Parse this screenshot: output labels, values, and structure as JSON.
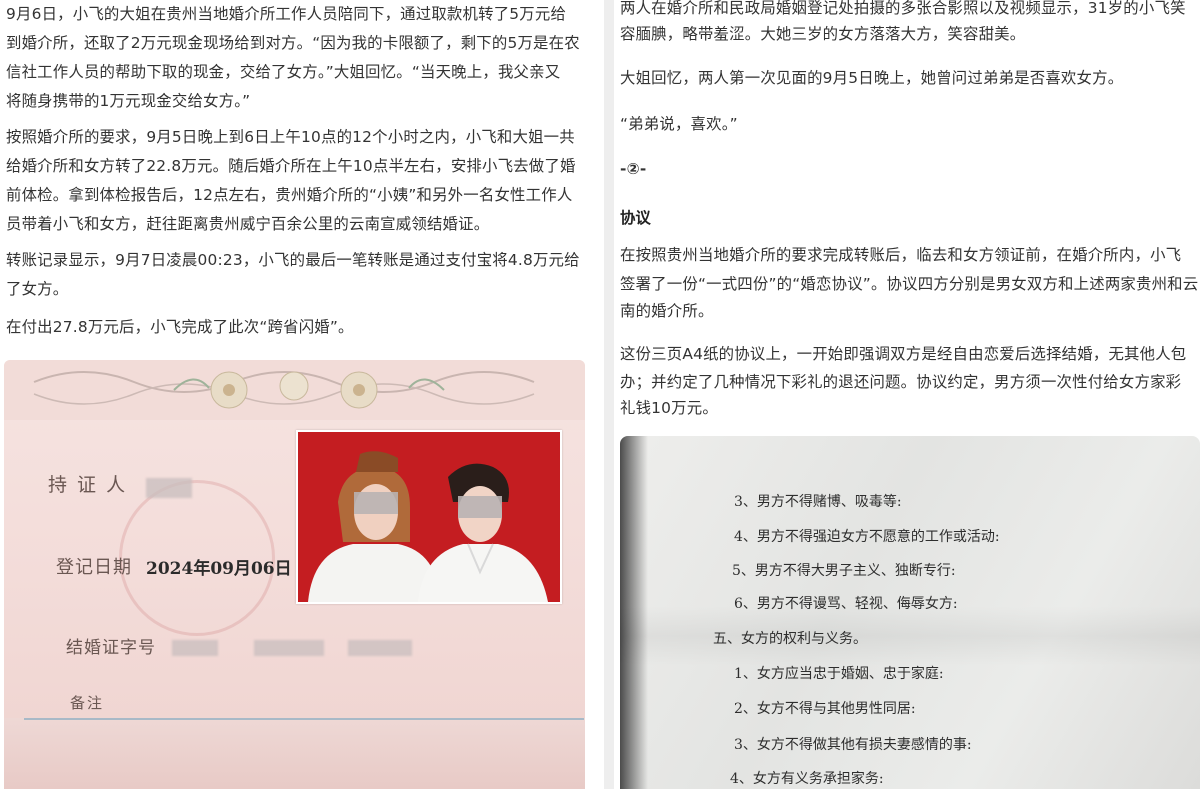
{
  "left": {
    "paragraphs": [
      "9月6日，小飞的大姐在贵州当地婚介所工作人员陪同下，通过取款机转了5万元给",
      "到婚介所，还取了2万元现金现场给到对方。“因为我的卡限额了，剩下的5万是在农",
      "信社工作人员的帮助下取的现金，交给了女方。”大姐回忆。“当天晚上，我父亲又",
      "将随身携带的1万元现金交给女方。”",
      "按照婚介所的要求，9月5日晚上到6日上午10点的12个小时之内，小飞和大姐一共",
      "给婚介所和女方转了22.8万元。随后婚介所在上午10点半左右，安排小飞去做了婚",
      "前体检。拿到体检报告后，12点左右，贵州婚介所的“小姨”和另外一名女性工作人",
      "员带着小飞和女方，赶往距离贵州威宁百余公里的云南宣威领结婚证。",
      "转账记录显示，9月7日凌晨00:23，小飞的最后一笔转账是通过支付宝将4.8万元给",
      "了女方。",
      "在付出27.8万元后，小飞完成了此次“跨省闪婚”。"
    ],
    "certificate": {
      "holder_label": "持 证 人",
      "date_label": "登记日期",
      "date_value": "2024年09月06日",
      "cert_no_label": "结婚证字号",
      "remark_label": "备注"
    }
  },
  "right": {
    "paragraphs": [
      "两人在婚介所和民政局婚姻登记处拍摄的多张合影照以及视频显示，31岁的小飞笑",
      "容腼腆，略带羞涩。大她三岁的女方落落大方，笑容甜美。",
      "大姐回忆，两人第一次见面的9月5日晚上，她曾问过弟弟是否喜欢女方。",
      "“弟弟说，喜欢。”",
      "-②-",
      "协议",
      "在按照贵州当地婚介所的要求完成转账后，临去和女方领证前，在婚介所内，小飞",
      "签署了一份“一式四份”的“婚恋协议”。协议四方分别是男女双方和上述两家贵州和云",
      "南的婚介所。",
      "这份三页A4纸的协议上，一开始即强调双方是经自由恋爱后选择结婚，无其他人包",
      "办；并约定了几种情况下彩礼的退还问题。协议约定，男方须一次性付给女方家彩",
      "礼钱10万元。"
    ],
    "agreement_lines": [
      "3、男方不得赌博、吸毒等:",
      "4、男方不得强迫女方不愿意的工作或活动:",
      "5、男方不得大男子主义、独断专行:",
      "6、男方不得谩骂、轻视、侮辱女方:",
      "五、女方的权利与义务。",
      "1、女方应当忠于婚姻、忠于家庭:",
      "2、女方不得与其他男性同居:",
      "3、女方不得做其他有损夫妻感情的事:",
      "4、女方有义务承担家务:"
    ]
  },
  "colors": {
    "text": "#333333",
    "page_divider": "#eeeeee",
    "certificate_pink": "#f3dcd9",
    "photo_red": "#c61e22",
    "paper_gray": "#e5e6e4"
  }
}
